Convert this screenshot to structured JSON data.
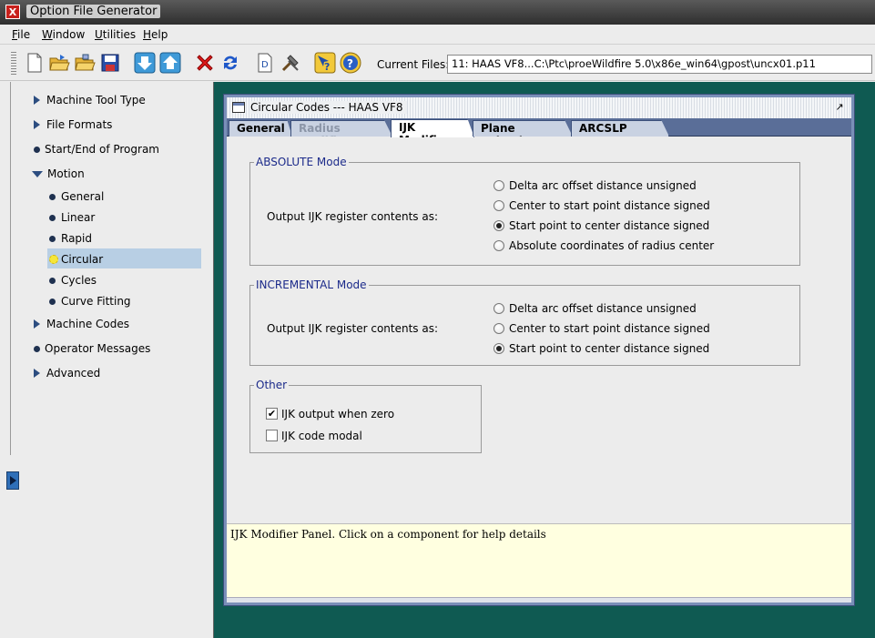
{
  "window": {
    "app_icon": "X",
    "title": "Option File Generator"
  },
  "menubar": {
    "items": [
      {
        "label": "File",
        "mnemonic_index": 0
      },
      {
        "label": "Window",
        "mnemonic_index": 0
      },
      {
        "label": "Utilities",
        "mnemonic_index": 0
      },
      {
        "label": "Help",
        "mnemonic_index": 0
      }
    ]
  },
  "toolbar": {
    "buttons": [
      "new-file-icon",
      "open-folder-icon",
      "open-recent-icon",
      "save-icon",
      "move-down-icon",
      "move-up-icon",
      "delete-icon",
      "refresh-icon",
      "document-d-icon",
      "tools-icon",
      "context-help-icon",
      "help-icon"
    ],
    "current_files_label": "Current Files:",
    "current_files_value": "11:  HAAS VF8...C:\\Ptc\\proeWildfire 5.0\\x86e_win64\\gpost\\uncx01.p11"
  },
  "tree": {
    "items": [
      {
        "label": "Machine Tool Type",
        "icon": "expand-right-icon"
      },
      {
        "label": "File Formats",
        "icon": "expand-right-icon"
      },
      {
        "label": "Start/End of Program",
        "icon": "bullet-icon"
      },
      {
        "label": "Motion",
        "icon": "expand-down-icon"
      },
      {
        "label": "General",
        "icon": "bullet-icon"
      },
      {
        "label": "Linear",
        "icon": "bullet-icon"
      },
      {
        "label": "Rapid",
        "icon": "bullet-icon"
      },
      {
        "label": "Circular",
        "icon": "selected-sun-icon"
      },
      {
        "label": "Cycles",
        "icon": "bullet-icon"
      },
      {
        "label": "Curve Fitting",
        "icon": "bullet-icon"
      },
      {
        "label": "Machine Codes",
        "icon": "expand-right-icon"
      },
      {
        "label": "Operator Messages",
        "icon": "bullet-icon"
      },
      {
        "label": "Advanced",
        "icon": "expand-right-icon"
      }
    ]
  },
  "frame": {
    "title": "Circular Codes --- HAAS VF8",
    "tabs": [
      {
        "label": "General",
        "state": "normal"
      },
      {
        "label": "Radius Modifier",
        "state": "disabled"
      },
      {
        "label": "IJK Modifier",
        "state": "active"
      },
      {
        "label": "Plane Selection",
        "state": "normal"
      },
      {
        "label": "ARCSLP Interp.",
        "state": "normal"
      }
    ],
    "absolute": {
      "legend": "ABSOLUTE Mode",
      "row_label": "Output IJK register contents as:",
      "options": [
        {
          "label": "Delta arc offset distance unsigned",
          "selected": false
        },
        {
          "label": "Center to start point distance signed",
          "selected": false
        },
        {
          "label": "Start point to center distance signed",
          "selected": true
        },
        {
          "label": "Absolute coordinates of radius center",
          "selected": false
        }
      ]
    },
    "incremental": {
      "legend": "INCREMENTAL Mode",
      "row_label": "Output IJK register contents as:",
      "options": [
        {
          "label": "Delta arc offset distance unsigned",
          "selected": false
        },
        {
          "label": "Center to start point distance signed",
          "selected": false
        },
        {
          "label": "Start point to center distance signed",
          "selected": true
        }
      ]
    },
    "other": {
      "legend": "Other",
      "checkboxes": [
        {
          "label": "IJK output when zero",
          "checked": true
        },
        {
          "label": "IJK code modal",
          "checked": false
        }
      ]
    },
    "help_text": "IJK Modifier Panel. Click on a component for help details"
  },
  "colors": {
    "desktop": "#0f5a52",
    "selection": "#b8cfe4",
    "legend": "#1b2a8a",
    "help_bg": "#ffffe0"
  }
}
